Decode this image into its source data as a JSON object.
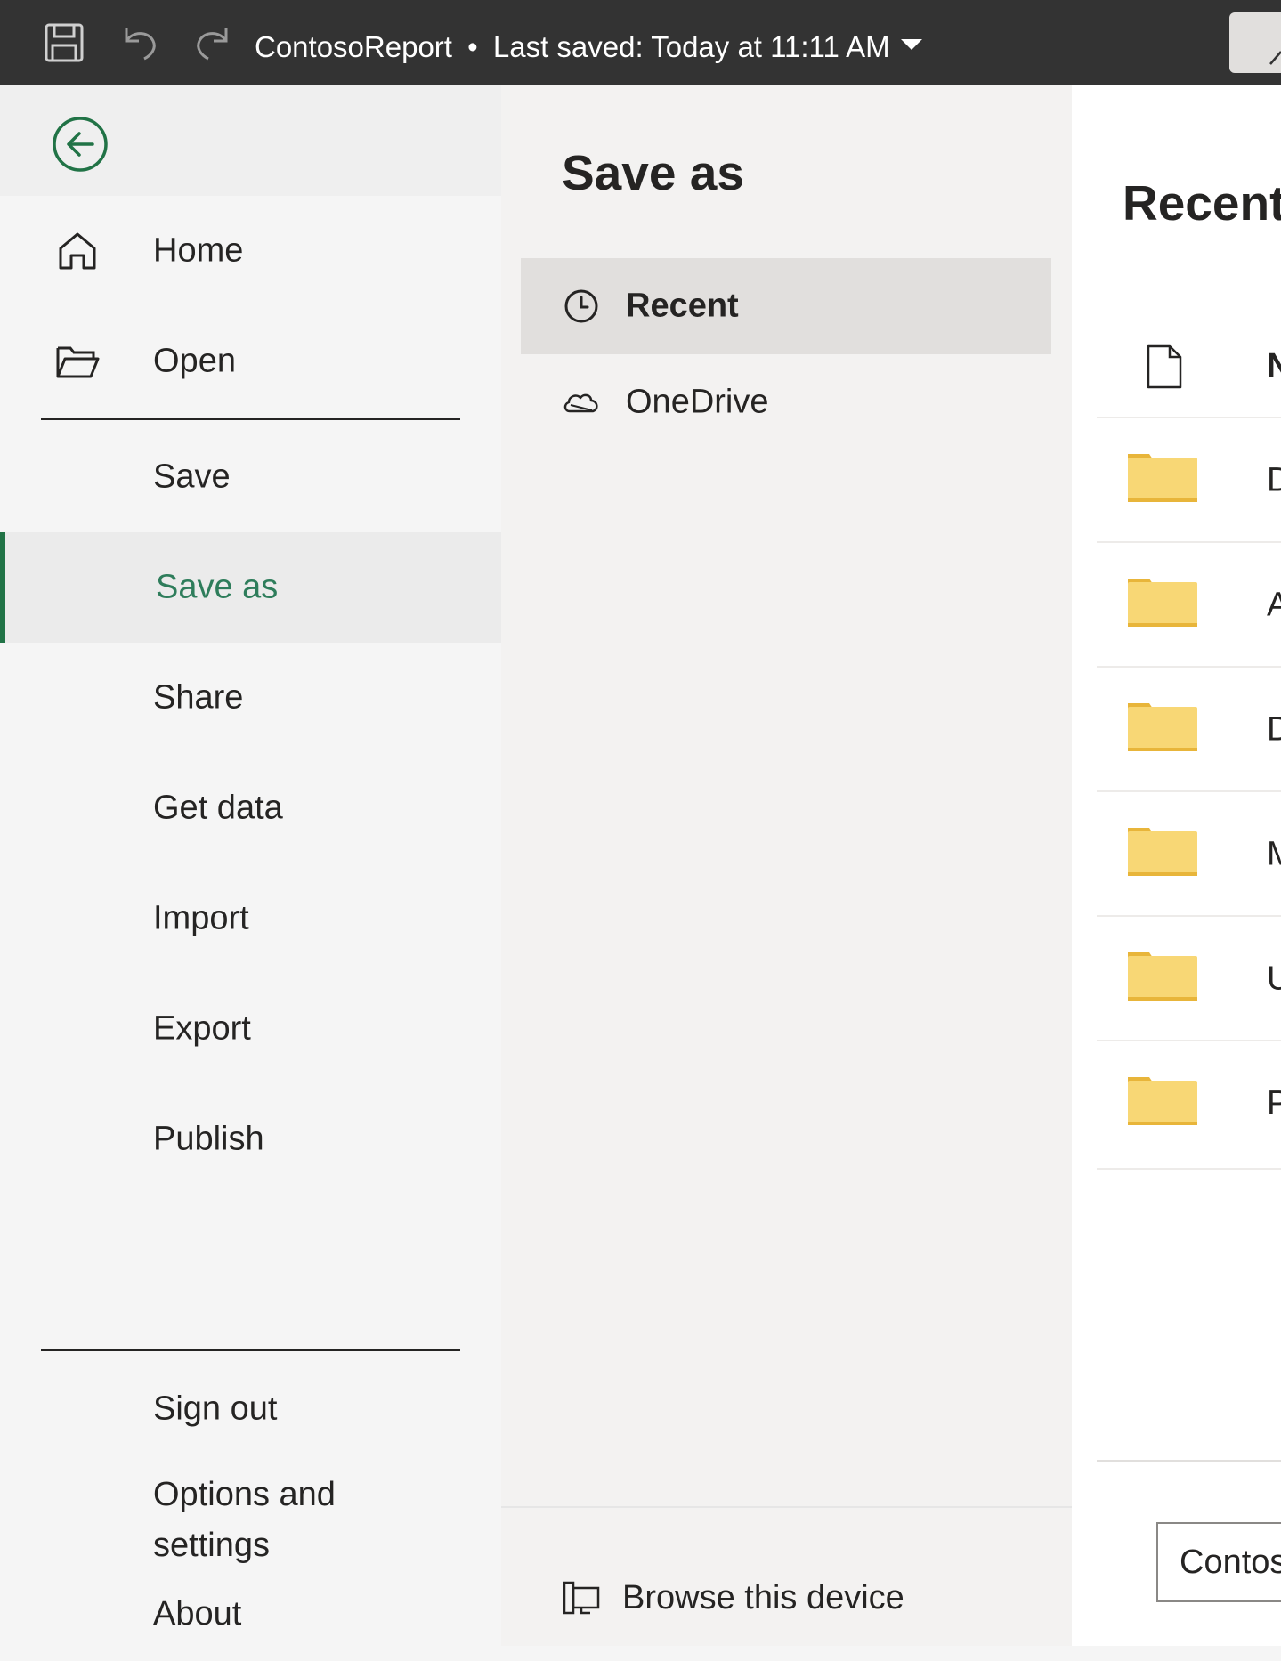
{
  "titlebar": {
    "title": "ContosoReport",
    "separator": "•",
    "last_saved": "Last saved: Today at 11:11 AM",
    "icons": [
      "save-icon",
      "undo-icon",
      "redo-icon",
      "dropdown-caret-icon"
    ]
  },
  "leftnav": {
    "back_icon": "back-arrow-icon",
    "items": [
      {
        "label": "Home",
        "icon": "home-icon"
      },
      {
        "label": "Open",
        "icon": "folder-open-icon"
      },
      {
        "label": "Save"
      },
      {
        "label": "Save as"
      },
      {
        "label": "Share"
      },
      {
        "label": "Get data"
      },
      {
        "label": "Import"
      },
      {
        "label": "Export"
      },
      {
        "label": "Publish"
      }
    ],
    "active_item": "Save as",
    "bottom_items": [
      {
        "label": "Sign out"
      },
      {
        "label": "Options and settings"
      },
      {
        "label": "About"
      }
    ]
  },
  "saveas": {
    "title": "Save as",
    "locations": [
      {
        "label": "Recent",
        "icon": "clock-icon",
        "selected": true
      },
      {
        "label": "OneDrive",
        "icon": "cloud-icon",
        "selected": false
      }
    ],
    "browse_label": "Browse this device"
  },
  "recent": {
    "title": "Recent",
    "column_name": "Na",
    "rows": [
      {
        "name": "Do"
      },
      {
        "name": "As"
      },
      {
        "name": "Do"
      },
      {
        "name": "MC"
      },
      {
        "name": "Un"
      },
      {
        "name": "Po"
      }
    ],
    "filename_value": "Contoso"
  },
  "colors": {
    "titlebar_bg": "#333333",
    "accent": "#217346",
    "active_text": "#2e7d5b",
    "folder": "#f8d775"
  }
}
